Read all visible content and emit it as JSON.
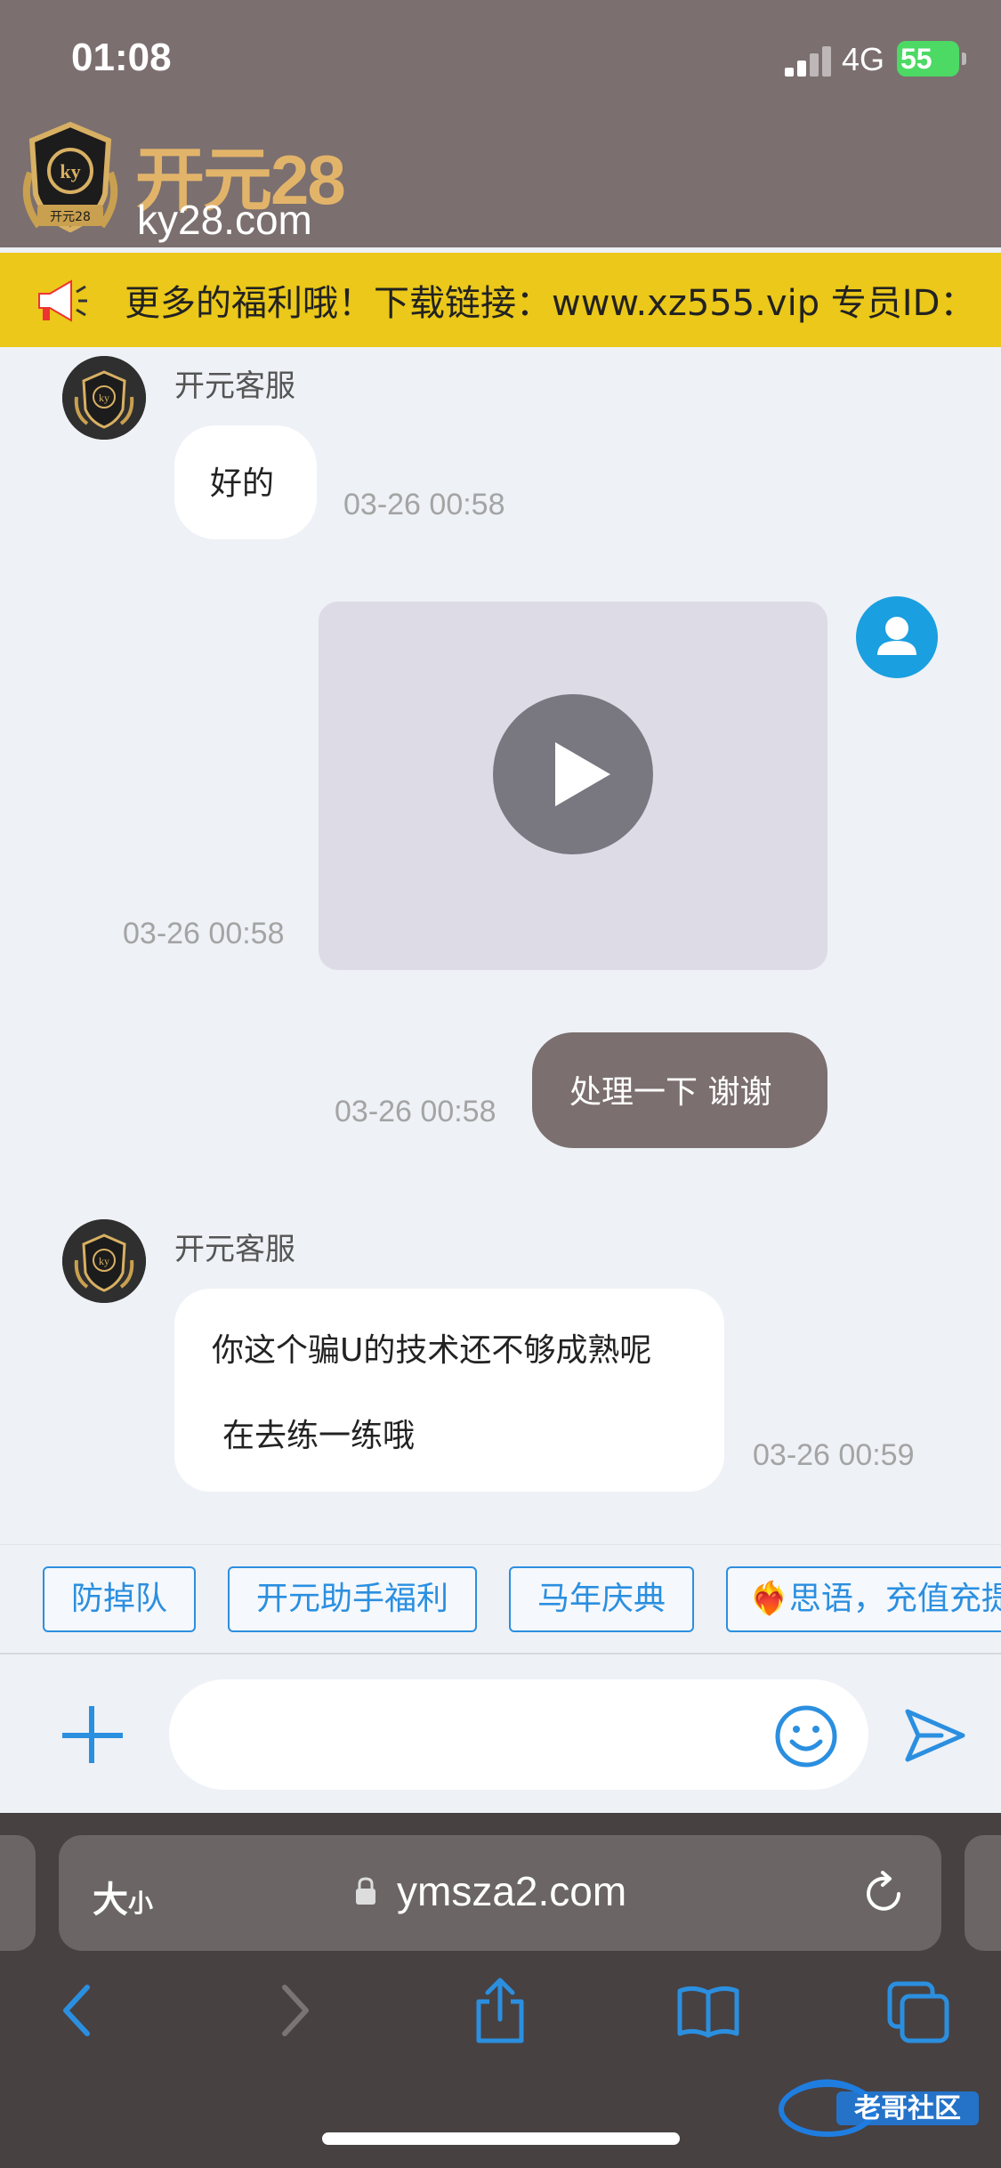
{
  "status_bar": {
    "time": "01:08",
    "network": "4G",
    "battery": "55"
  },
  "header": {
    "logo_cn": "开元28",
    "logo_en": "ky28.com",
    "badge_text": "开元28"
  },
  "marquee": {
    "text": "更多的福利哦！下载链接：www.xz555.vip 专员ID："
  },
  "messages": [
    {
      "sender": "开元客服",
      "text": "好的",
      "time": "03-26 00:58"
    },
    {
      "sender": "me",
      "type": "video",
      "time": "03-26 00:58"
    },
    {
      "sender": "me",
      "text": "处理一下 谢谢",
      "time": "03-26 00:58"
    },
    {
      "sender": "开元客服",
      "line1": "你这个骗U的技术还不够成熟呢",
      "line2": "在去练一练哦",
      "time": "03-26 00:59"
    }
  ],
  "quick_tags": [
    "防掉队",
    "开元助手福利",
    "马年庆典",
    "❤️‍🔥思语，充值充提"
  ],
  "input": {
    "placeholder": ""
  },
  "browser": {
    "text_size": "大",
    "text_size_small": "小",
    "url": "ymsza2.com"
  },
  "colors": {
    "header_bg": "#7b6f6f",
    "marquee_bg": "#ebc819",
    "accent": "#2b8fe0",
    "browser_bg": "#474142"
  },
  "icons": [
    "megaphone-icon",
    "play-icon",
    "user-icon",
    "plus-icon",
    "emoji-icon",
    "send-icon",
    "lock-icon",
    "reload-icon",
    "back-icon",
    "forward-icon",
    "share-icon",
    "bookmarks-icon",
    "tabs-icon"
  ]
}
